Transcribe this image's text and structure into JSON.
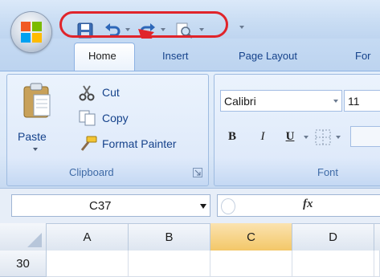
{
  "tabs": {
    "home": "Home",
    "insert": "Insert",
    "page_layout": "Page Layout",
    "formulas_partial": "For"
  },
  "clipboard": {
    "paste_label": "Paste",
    "cut_label": "Cut",
    "copy_label": "Copy",
    "format_painter_label": "Format Painter",
    "group_label": "Clipboard"
  },
  "font": {
    "font_name": "Calibri",
    "font_size": "11",
    "bold_label": "B",
    "italic_label": "I",
    "underline_label": "U",
    "group_label": "Font"
  },
  "formula_bar": {
    "name_box_value": "C37",
    "fx_label": "fx"
  },
  "grid": {
    "columns": [
      "A",
      "B",
      "C",
      "D"
    ],
    "rows": [
      "30"
    ],
    "selected_column": "C"
  },
  "colors": {
    "highlight_ring": "#e0242b",
    "arrow": "#e0242b",
    "tab_text": "#15428b",
    "selected_column_header": "#f7d48a"
  },
  "icons": [
    "office-button-icon",
    "save-icon",
    "undo-icon",
    "redo-icon",
    "print-preview-icon",
    "customize-qat-icon",
    "paste-icon",
    "cut-icon",
    "copy-icon",
    "format-painter-icon",
    "dialog-launcher-icon",
    "border-icon",
    "fx-icon"
  ]
}
